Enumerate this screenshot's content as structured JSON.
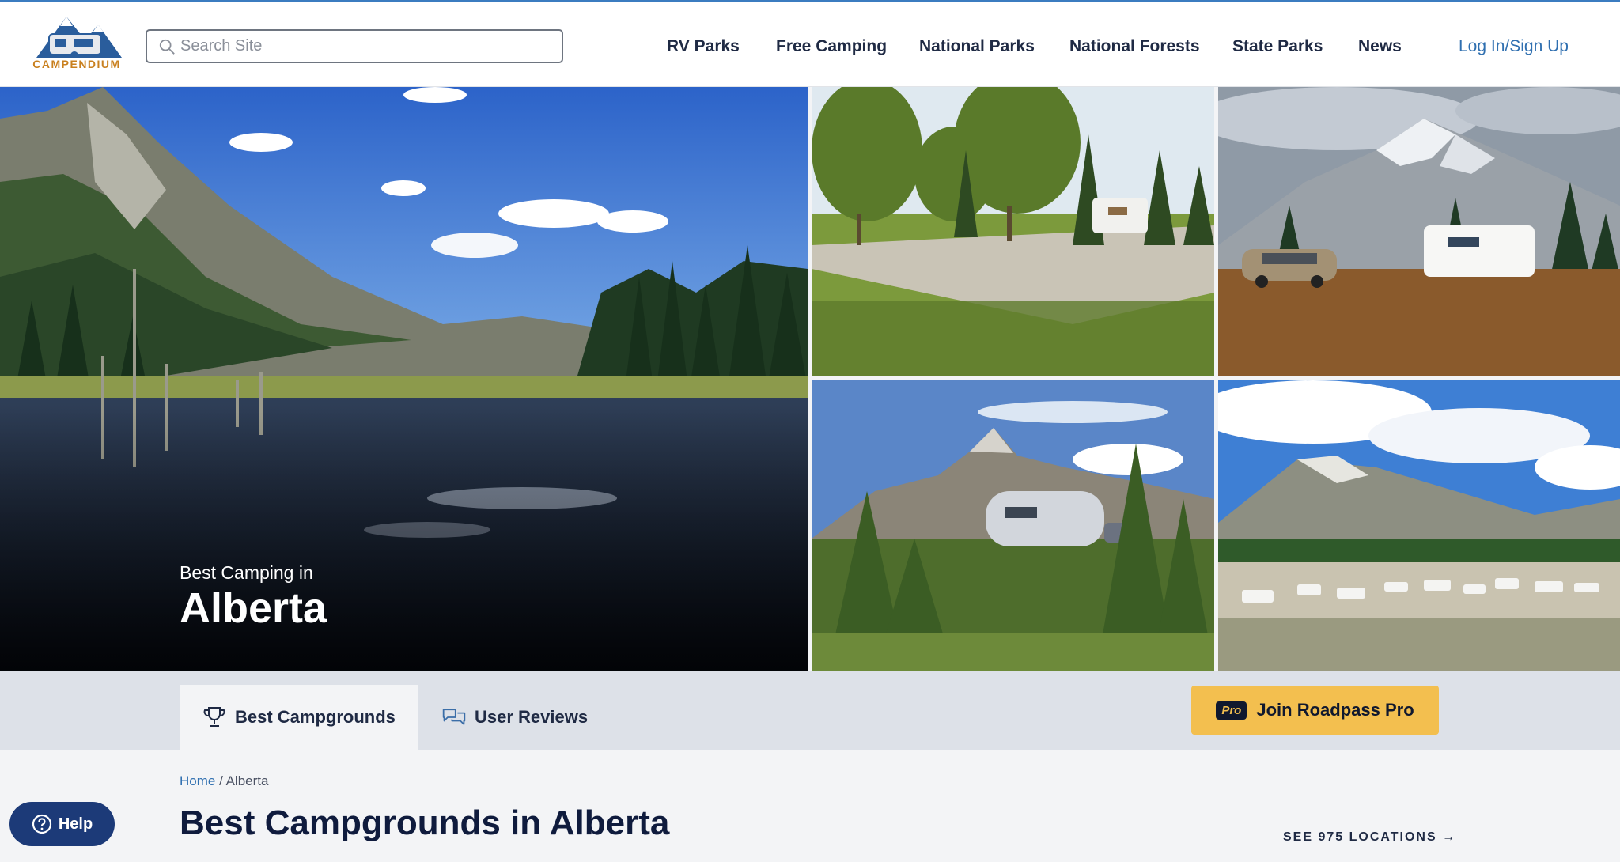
{
  "header": {
    "logo_text": "CAMPENDIUM",
    "search_placeholder": "Search Site",
    "nav": [
      "RV Parks",
      "Free Camping",
      "National Parks",
      "National Forests",
      "State Parks",
      "News"
    ],
    "login": "Log In/Sign Up"
  },
  "hero": {
    "subtitle": "Best Camping in",
    "title": "Alberta"
  },
  "tabs": {
    "best": "Best Campgrounds",
    "reviews": "User Reviews"
  },
  "pro": {
    "badge": "Pro",
    "label": "Join Roadpass Pro"
  },
  "breadcrumb": {
    "home": "Home",
    "separator": " / ",
    "current": "Alberta"
  },
  "main": {
    "title": "Best Campgrounds in Alberta",
    "see_all": "SEE 975 LOCATIONS →"
  },
  "help": {
    "label": "Help"
  },
  "icons": {
    "logo": "camper-mountain-logo",
    "search": "search-icon",
    "trophy": "trophy-icon",
    "reviews": "chat-bubbles-icon",
    "help": "question-circle-icon"
  },
  "colors": {
    "brand_blue": "#2f6fb0",
    "brand_orange": "#c9801f",
    "navy": "#0f1b3d",
    "pro_yellow": "#f3bf4f",
    "help_blue": "#1c3a78"
  }
}
